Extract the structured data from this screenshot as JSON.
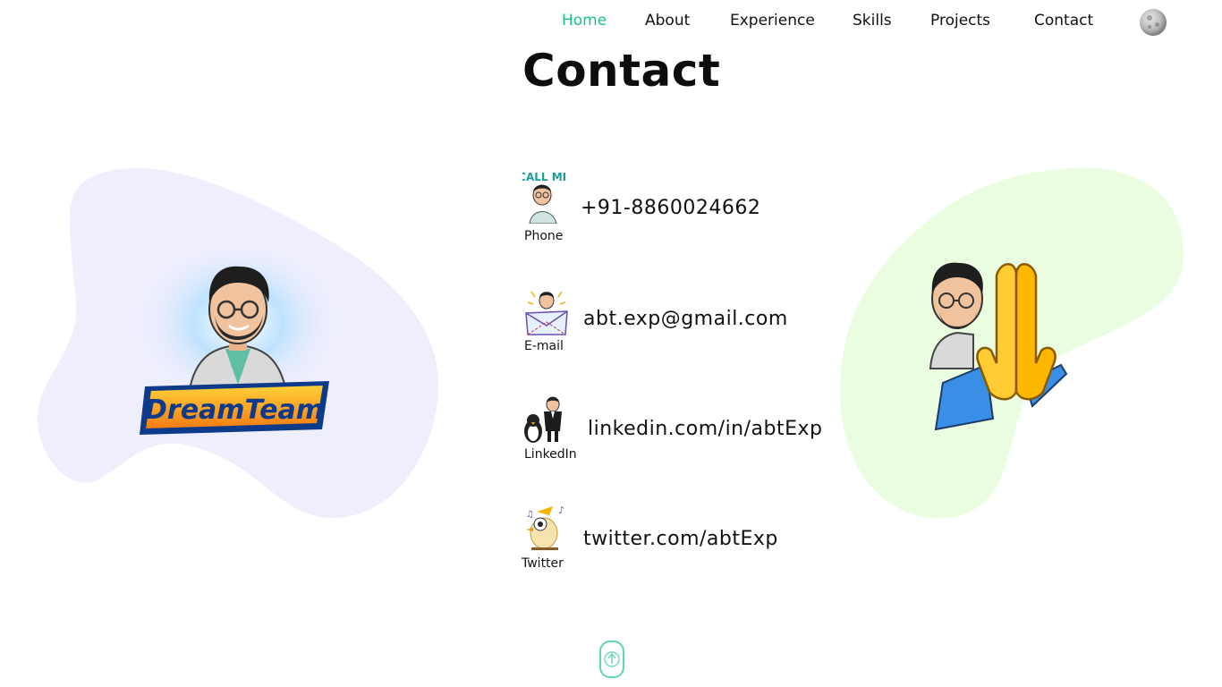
{
  "nav": {
    "items": [
      {
        "label": "Home",
        "active": true
      },
      {
        "label": "About",
        "active": false
      },
      {
        "label": "Experience",
        "active": false
      },
      {
        "label": "Skills",
        "active": false
      },
      {
        "label": "Projects",
        "active": false
      },
      {
        "label": "Contact",
        "active": false
      }
    ],
    "theme_toggle_icon": "moon-icon"
  },
  "section": {
    "title": "Contact"
  },
  "contacts": [
    {
      "label": "Phone",
      "value": "+91-8860024662",
      "icon": "call-me-avatar-icon"
    },
    {
      "label": "E-mail",
      "value": "abt.exp@gmail.com",
      "icon": "envelope-avatar-icon"
    },
    {
      "label": "LinkedIn",
      "value": "linkedin.com/in/abtExp",
      "icon": "penguin-avatar-icon"
    },
    {
      "label": "Twitter",
      "value": "twitter.com/abtExp",
      "icon": "bird-icon"
    }
  ],
  "left_illustration": {
    "badge_text": "DreamTeam",
    "blob_color": "#eeeefd"
  },
  "right_illustration": {
    "icon": "folded-hands-avatar-icon",
    "blob_color": "#eafde1"
  },
  "colors": {
    "accent": "#1bbf8e",
    "scroll_button": "#5fd6b4"
  },
  "scroll_top_icon": "arrow-up-icon"
}
